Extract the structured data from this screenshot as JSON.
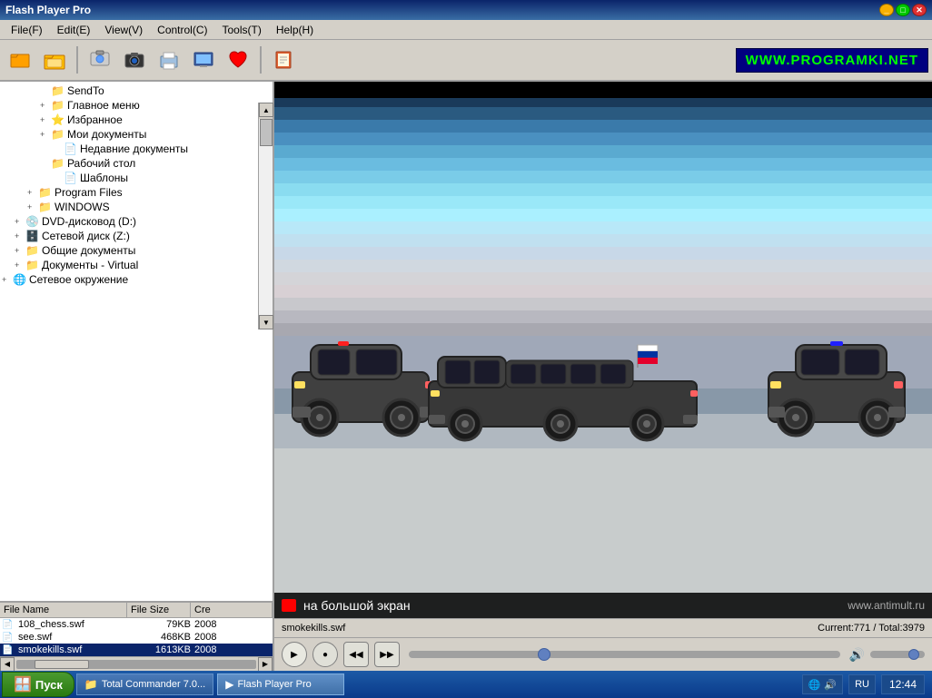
{
  "app": {
    "title": "Flash Player Pro"
  },
  "menu": {
    "items": [
      {
        "label": "File(F)",
        "id": "file"
      },
      {
        "label": "Edit(E)",
        "id": "edit"
      },
      {
        "label": "View(V)",
        "id": "view"
      },
      {
        "label": "Control(C)",
        "id": "control"
      },
      {
        "label": "Tools(T)",
        "id": "tools"
      },
      {
        "label": "Help(H)",
        "id": "help"
      }
    ]
  },
  "toolbar": {
    "website": "WWW.PROGRAMKI.NET"
  },
  "tree": {
    "items": [
      {
        "label": "SendTo",
        "indent": 3,
        "icon": "📁",
        "expand": ""
      },
      {
        "label": "Главное меню",
        "indent": 3,
        "icon": "📁",
        "expand": "+"
      },
      {
        "label": "Избранное",
        "indent": 3,
        "icon": "⭐",
        "expand": "+"
      },
      {
        "label": "Мои документы",
        "indent": 3,
        "icon": "📁",
        "expand": "+"
      },
      {
        "label": "Недавние документы",
        "indent": 4,
        "icon": "📄",
        "expand": ""
      },
      {
        "label": "Рабочий стол",
        "indent": 3,
        "icon": "📁",
        "expand": ""
      },
      {
        "label": "Шаблоны",
        "indent": 4,
        "icon": "📄",
        "expand": ""
      },
      {
        "label": "Program Files",
        "indent": 2,
        "icon": "📁",
        "expand": "+"
      },
      {
        "label": "WINDOWS",
        "indent": 2,
        "icon": "📁",
        "expand": "+"
      },
      {
        "label": "DVD-дисковод (D:)",
        "indent": 1,
        "icon": "💿",
        "expand": "+"
      },
      {
        "label": "Сетевой диск (Z:)",
        "indent": 1,
        "icon": "🗄️",
        "expand": "+"
      },
      {
        "label": "Общие документы",
        "indent": 1,
        "icon": "📁",
        "expand": "+"
      },
      {
        "label": "Документы - Virtual",
        "indent": 1,
        "icon": "📁",
        "expand": "+"
      },
      {
        "label": "Сетевое окружение",
        "indent": 0,
        "icon": "🌐",
        "expand": "+"
      }
    ]
  },
  "filelist": {
    "columns": [
      "File Name",
      "File Size",
      "Cre"
    ],
    "files": [
      {
        "name": "108_chess.swf",
        "size": "79KB",
        "date": "2008",
        "selected": false
      },
      {
        "name": "see.swf",
        "size": "468KB",
        "date": "2008",
        "selected": false
      },
      {
        "name": "smokekills.swf",
        "size": "1613KB",
        "date": "2008",
        "selected": true
      }
    ]
  },
  "video": {
    "overlay_text": "на большой экран",
    "overlay_right": "www.antimult.ru",
    "filename": "smokekills.swf",
    "position": "Current:771 / Total:3979"
  },
  "controls": {
    "play": "▶",
    "stop": "■",
    "prev": "◀◀",
    "next": "▶▶",
    "volume": "🔊"
  },
  "taskbar": {
    "start_label": "Пуск",
    "windows": [
      {
        "label": "Total Commander 7.0...",
        "active": false,
        "icon": "📁"
      },
      {
        "label": "Flash Player Pro",
        "active": true,
        "icon": "▶"
      }
    ],
    "lang": "RU",
    "time": "12:44"
  }
}
